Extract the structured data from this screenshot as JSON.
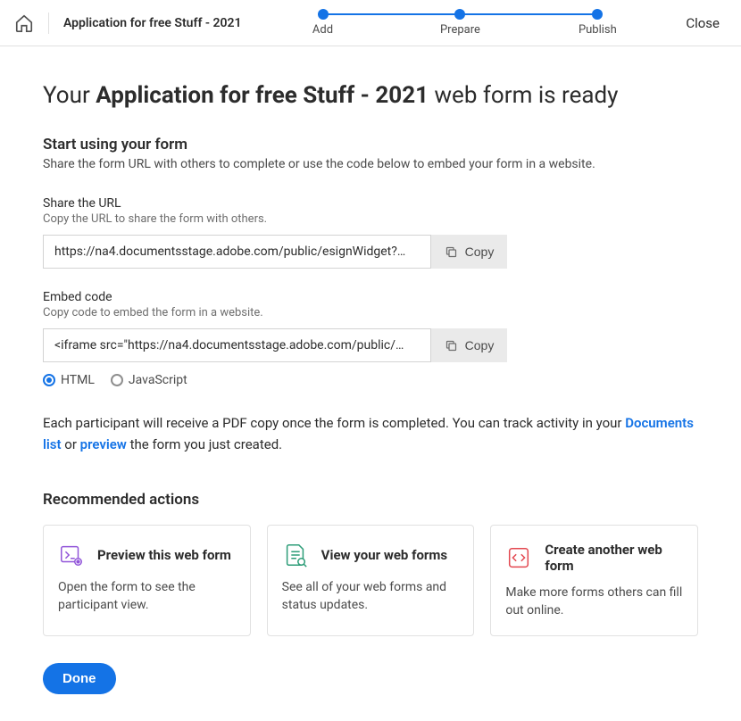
{
  "topbar": {
    "title": "Application for free Stuff - 2021",
    "steps": [
      "Add",
      "Prepare",
      "Publish"
    ],
    "close": "Close"
  },
  "heading": {
    "pre": "Your ",
    "bold": "Application for free Stuff - 2021",
    "post": " web form is ready"
  },
  "start": {
    "head": "Start using your form",
    "sub": "Share the form URL with others to complete or use the code below to embed your form in a website."
  },
  "url": {
    "label": "Share the URL",
    "sub": "Copy the URL to share the form with others.",
    "value": "https://na4.documentsstage.adobe.com/public/esignWidget?…",
    "copy": "Copy"
  },
  "embed": {
    "label": "Embed code",
    "sub": "Copy code to embed the form in a website.",
    "value": "<iframe src=\"https://na4.documentsstage.adobe.com/public/…",
    "copy": "Copy"
  },
  "radio": {
    "html": "HTML",
    "js": "JavaScript"
  },
  "info": {
    "t1": "Each participant will receive a PDF copy once the form is completed. You can track activity in your ",
    "link1": "Documents list",
    "t2": " or ",
    "link2": "preview",
    "t3": " the form you just created."
  },
  "rec": {
    "head": "Recommended actions",
    "cards": [
      {
        "title": "Preview this web form",
        "desc": "Open the form to see the participant view."
      },
      {
        "title": "View your web forms",
        "desc": "See all of your web forms and status updates."
      },
      {
        "title": "Create another web form",
        "desc": "Make more forms others can fill out online."
      }
    ]
  },
  "done": "Done"
}
